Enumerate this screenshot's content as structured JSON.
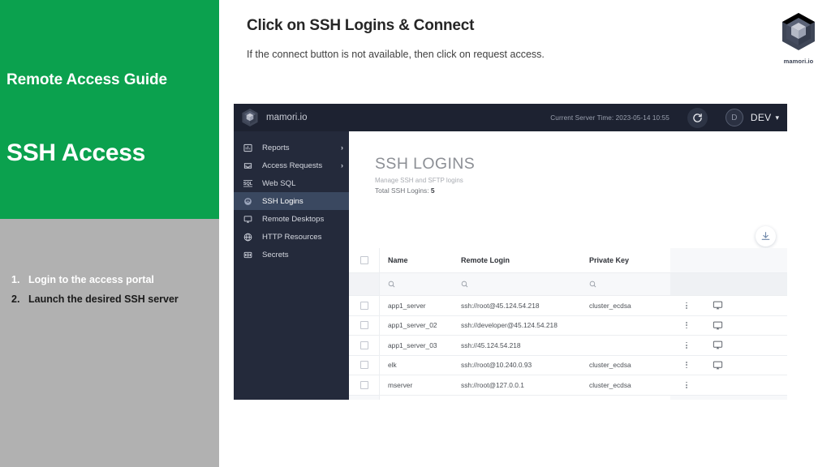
{
  "slide": {
    "kicker": "Remote Access Guide",
    "big_title": "SSH Access",
    "heading": "Click on SSH Logins & Connect",
    "subheading": "If the connect button is not available, then click on request access.",
    "green_color": "#0BA14E",
    "gray_color": "#b1b1b1",
    "steps": [
      {
        "num": "1.",
        "text": "Login to the access portal"
      },
      {
        "num": "2.",
        "text": "Launch the desired SSH server"
      }
    ]
  },
  "brand": {
    "name": "mamori.io",
    "icon": "hex-cube-logo"
  },
  "app": {
    "topbar": {
      "logo_text": "mamori.io",
      "server_time": "Current Server Time: 2023-05-14 10:55",
      "refresh_icon": "refresh-icon",
      "avatar_initial": "D",
      "tenant": "DEV",
      "caret": "⌄"
    },
    "sidebar": {
      "items": [
        {
          "label": "Reports",
          "icon": "bar-chart-icon",
          "caret": "›",
          "active": false
        },
        {
          "label": "Access Requests",
          "icon": "inbox-icon",
          "caret": "›",
          "active": false
        },
        {
          "label": "Web SQL",
          "icon": "sql-icon",
          "caret": "",
          "active": false
        },
        {
          "label": "SSH Logins",
          "icon": "fingerprint-icon",
          "caret": "",
          "active": true
        },
        {
          "label": "Remote Desktops",
          "icon": "monitor-icon",
          "caret": "",
          "active": false
        },
        {
          "label": "HTTP Resources",
          "icon": "globe-icon",
          "caret": "",
          "active": false
        },
        {
          "label": "Secrets",
          "icon": "safe-icon",
          "caret": "",
          "active": false
        }
      ]
    },
    "main": {
      "title": "SSH LOGINS",
      "description": "Manage SSH and SFTP logins",
      "count_label": "Total SSH Logins:",
      "count_value": "5",
      "download_icon": "download-icon",
      "table": {
        "columns": [
          "Name",
          "Remote Login",
          "Private Key"
        ],
        "filter_icon": "search-icon",
        "rows": [
          {
            "name": "app1_server",
            "login": "ssh://root@45.124.54.218",
            "key": "cluster_ecdsa",
            "connect": true
          },
          {
            "name": "app1_server_02",
            "login": "ssh://developer@45.124.54.218",
            "key": "",
            "connect": true
          },
          {
            "name": "app1_server_03",
            "login": "ssh://45.124.54.218",
            "key": "",
            "connect": true
          },
          {
            "name": "elk",
            "login": "ssh://root@10.240.0.93",
            "key": "cluster_ecdsa",
            "connect": true
          },
          {
            "name": "mserver",
            "login": "ssh://root@127.0.0.1",
            "key": "cluster_ecdsa",
            "connect": false
          }
        ]
      }
    }
  }
}
